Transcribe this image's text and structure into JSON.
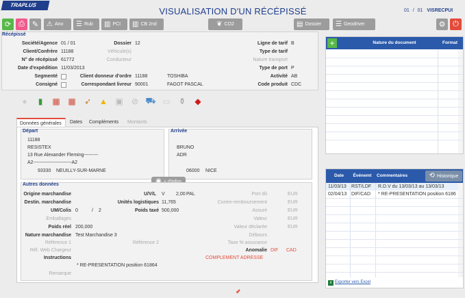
{
  "header": {
    "logo": "TRAPLUS",
    "title": "VISUALISATION D'UN RÉCÉPISSÉ",
    "page_current": "01",
    "page_sep": "/",
    "page_total": "01",
    "code": "VISRECPUI"
  },
  "toolbar": {
    "ano": "Ano",
    "rub": "Rub",
    "pci": "PCI",
    "cb2nd": "CB 2nd",
    "co2": "CO2",
    "dossier": "Dossier",
    "geodriver": "Geodriver"
  },
  "recepisse": {
    "section": "Récépissé",
    "societe_label": "Société/Agence",
    "societe_value": "01 / 01",
    "dossier_label": "Dossier",
    "dossier_value": "12",
    "client_label": "Client/Confrère",
    "client_value": "11188",
    "vehicule_label": "Véhicule(s)",
    "num_label": "N° de récépissé",
    "num_value": "61772",
    "conducteur_label": "Conducteur",
    "date_label": "Date d'expédition",
    "date_value": "11/03/2013",
    "segmente_label": "Segmenté",
    "donneur_label": "Client donneur d'ordre",
    "donneur_code": "11188",
    "donneur_name": "TOSHIBA",
    "consigne_label": "Consigné",
    "corresp_label": "Correspondant livreur",
    "corresp_code": "90001",
    "corresp_name": "FAGOT PASCAL",
    "ligne_label": "Ligne de tarif",
    "ligne_value": "B",
    "typetarif_label": "Type de tarif",
    "nature_transport_label": "Nature transport",
    "typeport_label": "Type de port",
    "typeport_value": "P",
    "activite_label": "Activité",
    "activite_value": "AB",
    "codeproduit_label": "Code produit",
    "codeproduit_value": "CDC"
  },
  "tabs": [
    "Données générales",
    "Dates",
    "Compléments",
    "Montants"
  ],
  "depart": {
    "section": "Départ",
    "code": "11188",
    "name": "RESISTEX",
    "street": "13 Rue Alexander Fleming---------",
    "a2": "A2------------------------A2",
    "cp": "93330",
    "city": "NEUILLY-SUR-MARNE"
  },
  "arrivee": {
    "section": "Arrivée",
    "name": "BRUNO",
    "extra": "ADR",
    "cp": "06000",
    "city": "NICE"
  },
  "details_button": "+ d'infos",
  "autres": {
    "section": "Autres données",
    "origine_label": "Origine marchandise",
    "uvl_label": "U/V/L",
    "uvl_value": "V",
    "pal_value": "2,00",
    "pal_unit": "PAL",
    "portdu_label": "Port dû",
    "eur1": "EUR",
    "destin_label": "Destin. marchandise",
    "unites_label": "Unités logistiques",
    "unites_value": "11,765",
    "contre_label": "Contre-remboursement",
    "eur2": "EUR",
    "um_label": "UM/Colis",
    "um_value": "0",
    "um_sep": "/",
    "um_value2": "2",
    "poids_taxe_label": "Poids taxé",
    "poids_taxe_value": "500,000",
    "assure_label": "Assuré",
    "eur3": "EUR",
    "emballages_label": "Emballages",
    "valeur_label": "Valeur",
    "eur4": "EUR",
    "poids_reel_label": "Poids réel",
    "poids_reel_value": "200,000",
    "valeur_dec_label": "Valeur déclarée",
    "eur5": "EUR",
    "nature_label": "Nature marchandise",
    "nature_value": "Test Marchandise 3",
    "debours_label": "Débours",
    "ref1_label": "Référence 1",
    "ref2_label": "Référence 2",
    "taxe_label": "Taxe % assurance",
    "refweb_label": "Réf. Web Chargeur",
    "anomalie_label": "Anomalie",
    "anomalie_v1": "DIF",
    "anomalie_v2": "CAD",
    "instructions_label": "Instructions",
    "complement": "COMPLEMENT ADRESSE",
    "representation": "* RE-PRESENTATION position  61864",
    "remarque_label": "Remarque"
  },
  "doc_table": {
    "col1": "Nature du document",
    "col2": "Format"
  },
  "events": {
    "col_date": "Date",
    "col_event": "Événemt",
    "col_comment": "Commentaires",
    "history_button": "Historique",
    "rows": [
      {
        "date": "11/03/13",
        "event": "RST/LDF",
        "comment": "R.D.V du 13/03/13 au 13/03/13"
      },
      {
        "date": "02/04/13",
        "event": "DIF/CAD",
        "comment": "* RE-PRESENTATION position   6186"
      }
    ],
    "export": "Exporter vers Excel"
  }
}
